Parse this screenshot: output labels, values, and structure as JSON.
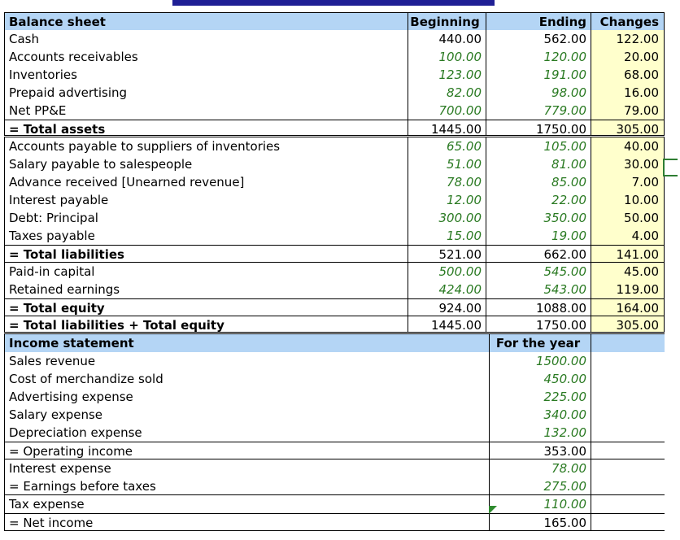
{
  "balance_sheet": {
    "headers": {
      "label": "Balance sheet",
      "beginning": "Beginning",
      "ending": "Ending",
      "changes": "Changes"
    },
    "assets": [
      {
        "label": "Cash",
        "beginning": "440.00",
        "ending": "562.00",
        "changes": "122.00",
        "input": false
      },
      {
        "label": "Accounts receivables",
        "beginning": "100.00",
        "ending": "120.00",
        "changes": "20.00",
        "input": true
      },
      {
        "label": "Inventories",
        "beginning": "123.00",
        "ending": "191.00",
        "changes": "68.00",
        "input": true
      },
      {
        "label": "Prepaid advertising",
        "beginning": "82.00",
        "ending": "98.00",
        "changes": "16.00",
        "input": true
      },
      {
        "label": "Net PP&E",
        "beginning": "700.00",
        "ending": "779.00",
        "changes": "79.00",
        "input": true
      }
    ],
    "total_assets": {
      "label": "= Total assets",
      "beginning": "1445.00",
      "ending": "1750.00",
      "changes": "305.00"
    },
    "liabilities": [
      {
        "label": "Accounts payable to suppliers of inventories",
        "beginning": "65.00",
        "ending": "105.00",
        "changes": "40.00"
      },
      {
        "label": "Salary payable to salespeople",
        "beginning": "51.00",
        "ending": "81.00",
        "changes": "30.00"
      },
      {
        "label": "Advance received [Unearned revenue]",
        "beginning": "78.00",
        "ending": "85.00",
        "changes": "7.00"
      },
      {
        "label": "Interest payable",
        "beginning": "12.00",
        "ending": "22.00",
        "changes": "10.00"
      },
      {
        "label": "Debt: Principal",
        "beginning": "300.00",
        "ending": "350.00",
        "changes": "50.00"
      },
      {
        "label": "Taxes payable",
        "beginning": "15.00",
        "ending": "19.00",
        "changes": "4.00"
      }
    ],
    "total_liabilities": {
      "label": "= Total liabilities",
      "beginning": "521.00",
      "ending": "662.00",
      "changes": "141.00"
    },
    "equity": [
      {
        "label": "Paid-in capital",
        "beginning": "500.00",
        "ending": "545.00",
        "changes": "45.00"
      },
      {
        "label": "Retained earnings",
        "beginning": "424.00",
        "ending": "543.00",
        "changes": "119.00"
      }
    ],
    "total_equity": {
      "label": "= Total equity",
      "beginning": "924.00",
      "ending": "1088.00",
      "changes": "164.00"
    },
    "total_le": {
      "label": "= Total liabilities + Total equity",
      "beginning": "1445.00",
      "ending": "1750.00",
      "changes": "305.00"
    }
  },
  "income_statement": {
    "headers": {
      "label": "Income statement",
      "value": "For the year"
    },
    "rows": [
      {
        "label": "Sales revenue",
        "value": "1500.00"
      },
      {
        "label": "Cost of merchandize sold",
        "value": "450.00"
      },
      {
        "label": "Advertising expense",
        "value": "225.00"
      },
      {
        "label": "Salary expense",
        "value": "340.00"
      },
      {
        "label": "Depreciation expense",
        "value": "132.00"
      },
      {
        "label": "= Operating income",
        "value": "353.00"
      },
      {
        "label": "Interest expense",
        "value": "78.00"
      },
      {
        "label": "= Earnings before taxes",
        "value": "275.00"
      },
      {
        "label": "Tax expense",
        "value": "110.00"
      },
      {
        "label": "= Net income",
        "value": "165.00"
      }
    ]
  },
  "colors": {
    "header_bg": "#b4d5f5",
    "changes_bg": "#ffffcc",
    "input_text": "#2a7a22",
    "top_bar": "#1f1f95"
  }
}
